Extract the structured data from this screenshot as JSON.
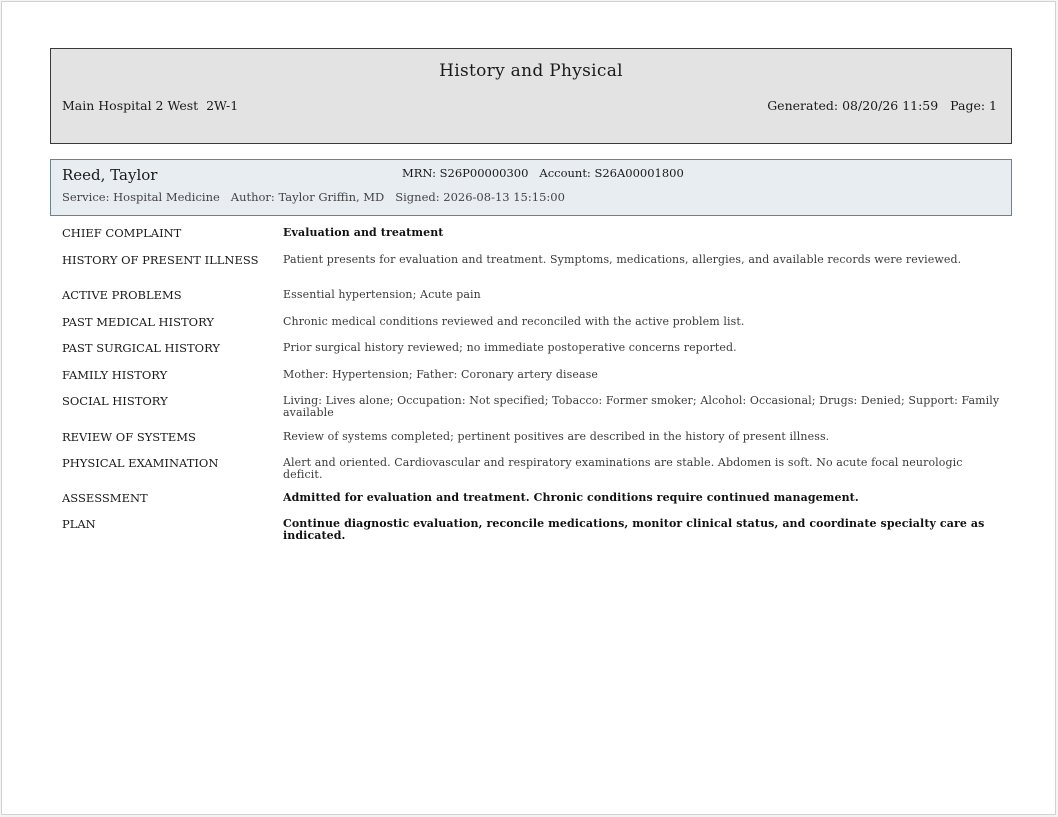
{
  "header": {
    "title": "History and Physical",
    "location": "Main Hospital 2 West  2W-1",
    "generated_label": "Generated:",
    "generated_value": "08/20/26 11:59",
    "page_label": "Page:",
    "page_value": "1"
  },
  "patient": {
    "name": "Reed, Taylor",
    "mrn_label": "MRN:",
    "mrn": "S26P00000300",
    "account_label": "Account:",
    "account": "S26A00001800",
    "service_label": "Service:",
    "service": "Hospital Medicine",
    "author_label": "Author:",
    "author": "Taylor Griffin, MD",
    "signed_label": "Signed:",
    "signed": "2026-08-13 15:15:00"
  },
  "sections": [
    {
      "label": "CHIEF COMPLAINT",
      "text": "Evaluation and treatment"
    },
    {
      "label": "HISTORY OF PRESENT ILLNESS",
      "text": "Patient presents for evaluation and treatment. Symptoms, medications, allergies, and available records were reviewed."
    },
    {
      "label": "ACTIVE PROBLEMS",
      "text": "Essential hypertension; Acute pain"
    },
    {
      "label": "PAST MEDICAL HISTORY",
      "text": "Chronic medical conditions reviewed and reconciled with the active problem list."
    },
    {
      "label": "PAST SURGICAL HISTORY",
      "text": "Prior surgical history reviewed; no immediate postoperative concerns reported."
    },
    {
      "label": "FAMILY HISTORY",
      "text": "Mother: Hypertension; Father: Coronary artery disease"
    },
    {
      "label": "SOCIAL HISTORY",
      "text": "Living: Lives alone; Occupation: Not specified; Tobacco: Former smoker; Alcohol: Occasional; Drugs: Denied; Support: Family available"
    },
    {
      "label": "REVIEW OF SYSTEMS",
      "text": "Review of systems completed; pertinent positives are described in the history of present illness."
    },
    {
      "label": "PHYSICAL EXAMINATION",
      "text": "Alert and oriented. Cardiovascular and respiratory examinations are stable. Abdomen is soft. No acute focal neurologic deficit."
    },
    {
      "label": "ASSESSMENT",
      "text": "Admitted for evaluation and treatment. Chronic conditions require continued management."
    },
    {
      "label": "PLAN",
      "text": "Continue diagnostic evaluation, reconcile medications, monitor clinical status, and coordinate specialty care as indicated."
    }
  ]
}
